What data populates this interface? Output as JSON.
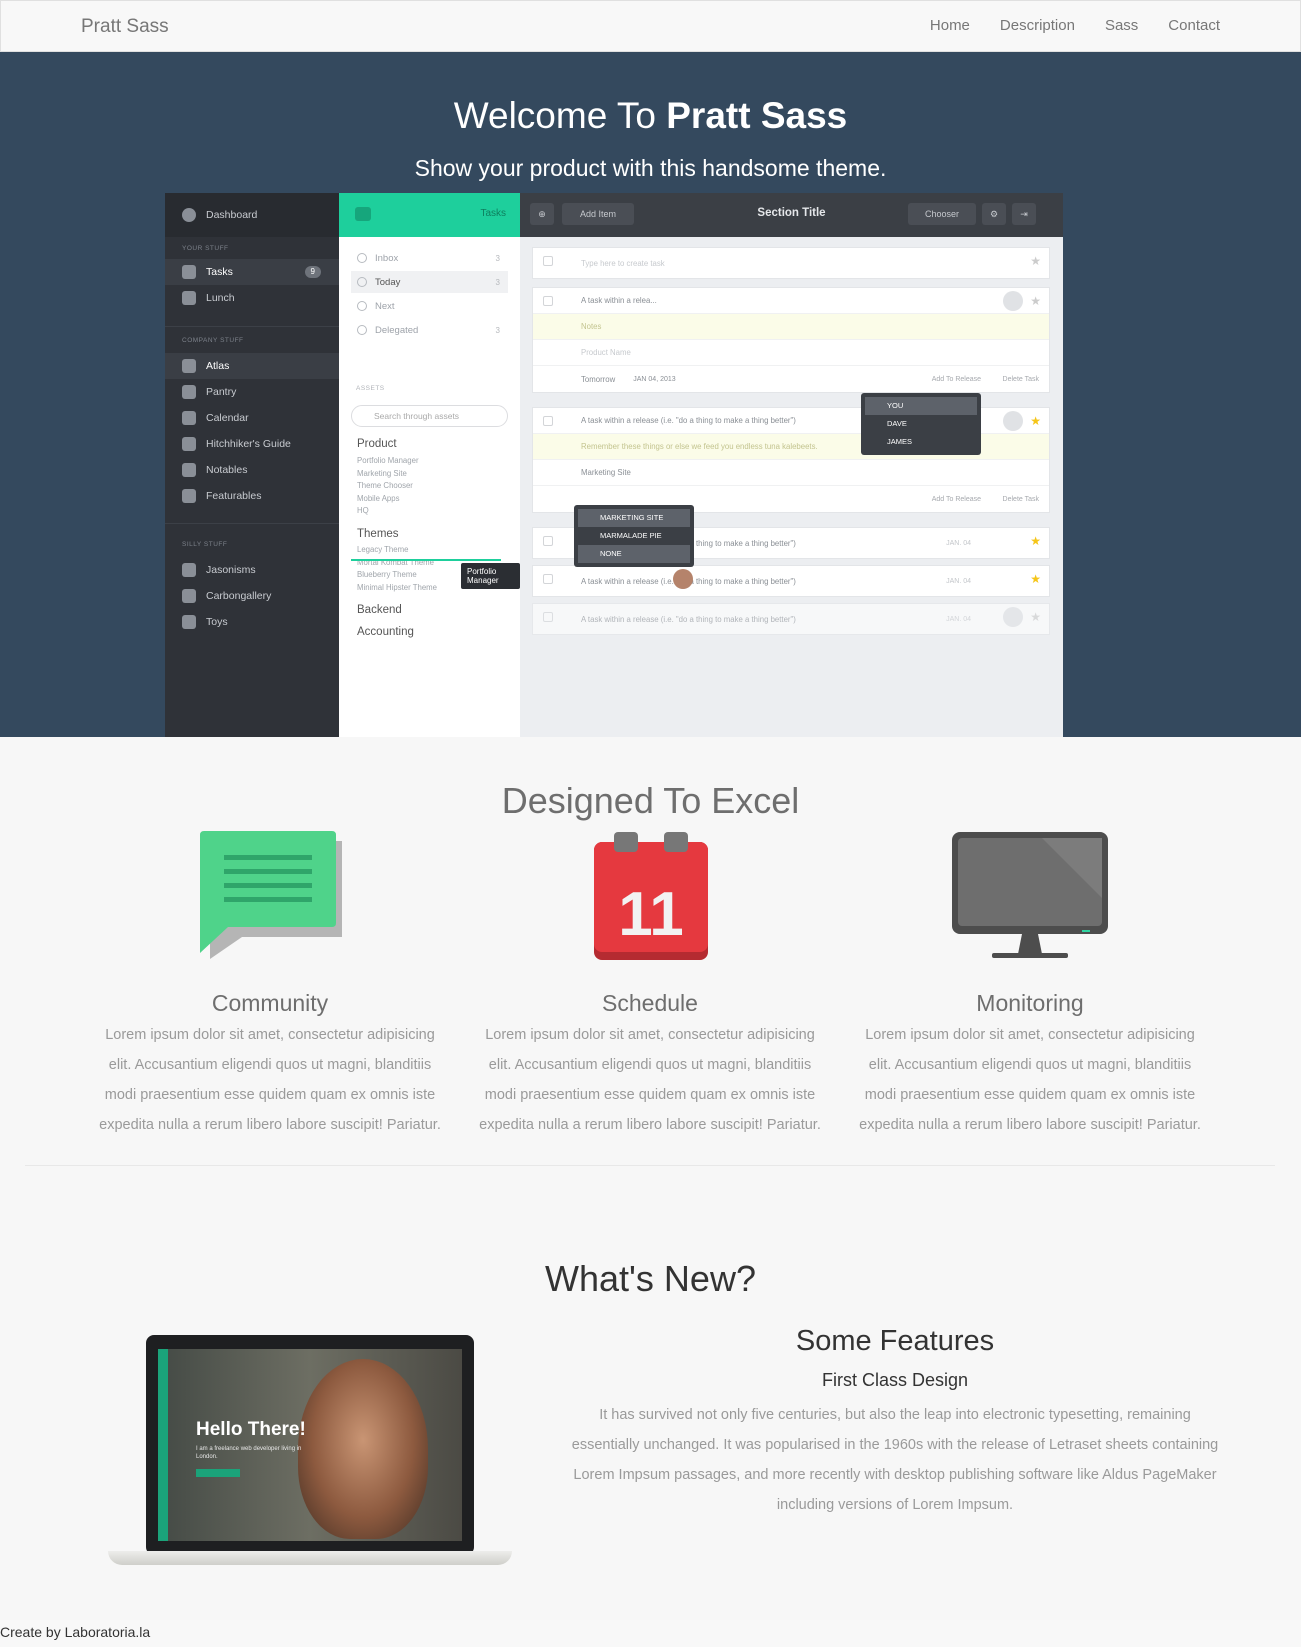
{
  "navbar": {
    "brand": "Pratt Sass",
    "links": [
      "Home",
      "Description",
      "Sass",
      "Contact"
    ]
  },
  "hero": {
    "title_prefix": "Welcome To",
    "title_bold": "Pratt Sass",
    "subtitle": "Show your product with this handsome theme."
  },
  "app": {
    "sidebar": {
      "dashboard": "Dashboard",
      "your_stuff_heading": "YOUR STUFF",
      "your_stuff": [
        {
          "label": "Tasks",
          "badge": "9"
        },
        {
          "label": "Lunch"
        }
      ],
      "company_heading": "COMPANY STUFF",
      "company": [
        "Atlas",
        "Pantry",
        "Calendar",
        "Hitchhiker's Guide",
        "Notables",
        "Featurables"
      ],
      "silly_heading": "SILLY STUFF",
      "silly": [
        "Jasonisms",
        "Carbongallery",
        "Toys"
      ]
    },
    "middle": {
      "header": "Tasks",
      "lists": [
        {
          "label": "Inbox",
          "count": "3"
        },
        {
          "label": "Today",
          "count": "3"
        },
        {
          "label": "Next",
          "count": ""
        },
        {
          "label": "Delegated",
          "count": "3"
        }
      ],
      "assets_heading": "ASSETS",
      "search_placeholder": "Search through assets",
      "groups": [
        {
          "name": "Product",
          "items": [
            "Portfolio Manager",
            "Marketing Site",
            "Theme Chooser",
            "Mobile Apps",
            "HQ"
          ]
        },
        {
          "name": "Themes",
          "items": [
            "Legacy Theme",
            "Mortal Kombat Theme",
            "Blueberry Theme",
            "Minimal Hipster Theme"
          ]
        },
        {
          "name": "Backend",
          "items": []
        },
        {
          "name": "Accounting",
          "items": []
        }
      ],
      "tooltip": "Portfolio Manager"
    },
    "main": {
      "add_item": "Add Item",
      "section_title": "Section Title",
      "chooser": "Chooser",
      "new_task_placeholder": "Type here to create task",
      "task1": {
        "title": "A task within a relea...",
        "notes": "Notes",
        "product": "Product Name",
        "due": "Tomorrow",
        "date": "JAN 04, 2013",
        "add_release": "Add To Release",
        "delete": "Delete Task"
      },
      "assignees": [
        "YOU",
        "DAVE",
        "JAMES"
      ],
      "task2": {
        "title": "A task within a release (i.e. \"do a thing to make a thing better\")",
        "note": "Remember these things or else we feed you endless tuna kalebeets.",
        "input": "Marketing Site",
        "add_release": "Add To Release",
        "delete": "Delete Task"
      },
      "release_options": [
        "MARKETING SITE",
        "MARMALADE PIE",
        "NONE"
      ],
      "tasks": [
        {
          "title": "A task within a release (i.e. \"do a thing to make a thing better\")",
          "date": "JAN. 04"
        },
        {
          "title": "A task within a release (i.e. \"do a thing to make a thing better\")",
          "date": "JAN. 04"
        },
        {
          "title": "A task within a release (i.e. \"do a thing to make a thing better\")",
          "date": "JAN. 04"
        }
      ]
    }
  },
  "designed": {
    "heading": "Designed To Excel",
    "features": [
      {
        "title": "Community",
        "icon": "chat-bubble-icon",
        "body": "Lorem ipsum dolor sit amet, consectetur adipisicing elit. Accusantium eligendi quos ut magni, blanditiis modi praesentium esse quidem quam ex omnis iste expedita nulla a rerum libero labore suscipit! Pariatur."
      },
      {
        "title": "Schedule",
        "icon": "calendar-icon",
        "calendar_day": "11",
        "body": "Lorem ipsum dolor sit amet, consectetur adipisicing elit. Accusantium eligendi quos ut magni, blanditiis modi praesentium esse quidem quam ex omnis iste expedita nulla a rerum libero labore suscipit! Pariatur."
      },
      {
        "title": "Monitoring",
        "icon": "monitor-icon",
        "body": "Lorem ipsum dolor sit amet, consectetur adipisicing elit. Accusantium eligendi quos ut magni, blanditiis modi praesentium esse quidem quam ex omnis iste expedita nulla a rerum libero labore suscipit! Pariatur."
      }
    ]
  },
  "whats_new": {
    "heading": "What's New?",
    "laptop": {
      "hello": "Hello There!",
      "sub": "I am a freelance web developer living in London."
    },
    "title": "Some Features",
    "subtitle": "First Class Design",
    "body": "It has survived not only five centuries, but also the leap into electronic typesetting, remaining essentially unchanged. It was popularised in the 1960s with the release of Letraset sheets containing Lorem Impsum passages, and more recently with desktop publishing software like Aldus PageMaker including versions of Lorem Impsum."
  },
  "footer": {
    "text": "Create by Laboratoria.la"
  },
  "colors": {
    "hero_bg": "#34495e",
    "accent_green": "#1ecf9c",
    "calendar_red": "#e5393f",
    "chat_green": "#4fd38a"
  }
}
